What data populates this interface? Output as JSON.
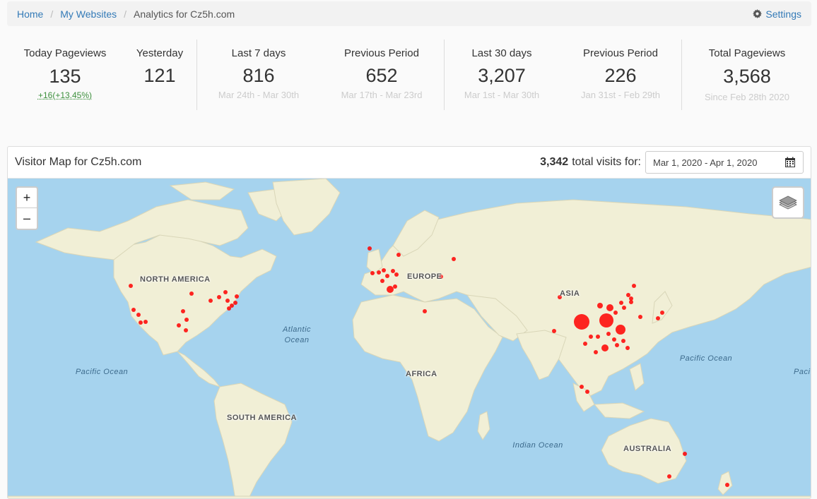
{
  "breadcrumb": {
    "home": "Home",
    "my_websites": "My Websites",
    "current": "Analytics for Cz5h.com",
    "settings": "Settings"
  },
  "stats": {
    "today": {
      "label": "Today Pageviews",
      "value": "135",
      "delta": "+16(+13.45%)"
    },
    "yesterday": {
      "label": "Yesterday",
      "value": "121"
    },
    "last7": {
      "label": "Last 7 days",
      "value": "816",
      "range": "Mar 24th - Mar 30th"
    },
    "prev7": {
      "label": "Previous Period",
      "value": "652",
      "range": "Mar 17th - Mar 23rd"
    },
    "last30": {
      "label": "Last 30 days",
      "value": "3,207",
      "range": "Mar 1st - Mar 30th"
    },
    "prev30": {
      "label": "Previous Period",
      "value": "226",
      "range": "Jan 31st - Feb 29th"
    },
    "total": {
      "label": "Total Pageviews",
      "value": "3,568",
      "range": "Since Feb 28th 2020"
    }
  },
  "visitor_map": {
    "title": "Visitor Map for Cz5h.com",
    "total_visits": "3,342",
    "total_visits_label": "total visits for:",
    "date_range": "Mar 1, 2020 - Apr 1, 2020",
    "zoom_in": "+",
    "zoom_out": "–",
    "region_labels": {
      "north_america": "NORTH AMERICA",
      "south_america": "SOUTH AMERICA",
      "europe": "EUROPE",
      "africa": "AFRICA",
      "asia": "ASIA",
      "australia": "AUSTRALIA"
    },
    "ocean_labels": {
      "atlantic_1": "Atlantic",
      "atlantic_2": "Ocean",
      "pacific_west": "Pacific Ocean",
      "pacific_east": "Pacific Ocean",
      "indian": "Indian Ocean",
      "pacific_edge": "Paci"
    },
    "marker_color": "#ff0000",
    "land_color": "#f1efd6",
    "water_color": "#a6d3ee"
  },
  "icons": {
    "settings": "gear-icon",
    "calendar": "calendar-icon",
    "layers": "layers-icon"
  }
}
